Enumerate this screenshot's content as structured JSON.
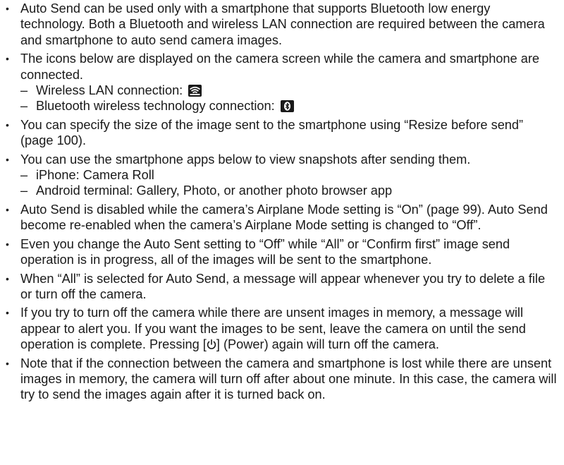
{
  "notes": [
    {
      "text": "Auto Send can be used only with a smartphone that supports Bluetooth low energy technology. Both a Bluetooth and wireless LAN connection are required between the camera and smartphone to auto send camera images."
    },
    {
      "text": "The icons below are displayed on the camera screen while the camera and smartphone are connected.",
      "subitems": [
        {
          "text": "Wireless LAN connection:",
          "icon": "wireless-lan-icon"
        },
        {
          "text": "Bluetooth wireless technology connection:",
          "icon": "bluetooth-icon"
        }
      ]
    },
    {
      "text": "You can specify the size of the image sent to the smartphone using “Resize before send” (page 100)."
    },
    {
      "text": "You can use the smartphone apps below to view snapshots after sending them.",
      "subitems": [
        {
          "text": "iPhone: Camera Roll"
        },
        {
          "text": "Android terminal: Gallery, Photo, or another photo browser app"
        }
      ]
    },
    {
      "text": "Auto Send is disabled while the camera’s Airplane Mode setting is “On” (page 99). Auto Send become re-enabled when the camera’s Airplane Mode setting is changed to “Off”."
    },
    {
      "text": "Even you change the Auto Sent setting to “Off” while “All” or “Confirm first” image send operation is in progress, all of the images will be sent to the smartphone."
    },
    {
      "text": "When “All” is selected for Auto Send, a message will appear whenever you try to delete a file or turn off the camera."
    },
    {
      "text_before": "If you try to turn off the camera while there are unsent images in memory, a message will appear to alert you. If you want the images to be sent, leave the camera on until the send operation is complete. Pressing [",
      "inline_icon": "power-icon",
      "text_after": "] (Power) again will turn off the camera."
    },
    {
      "text": "Note that if the connection between the camera and smartphone is lost while there are unsent images in memory, the camera will turn off after about one minute. In this case, the camera will try to send the images again after it is turned back on."
    }
  ]
}
